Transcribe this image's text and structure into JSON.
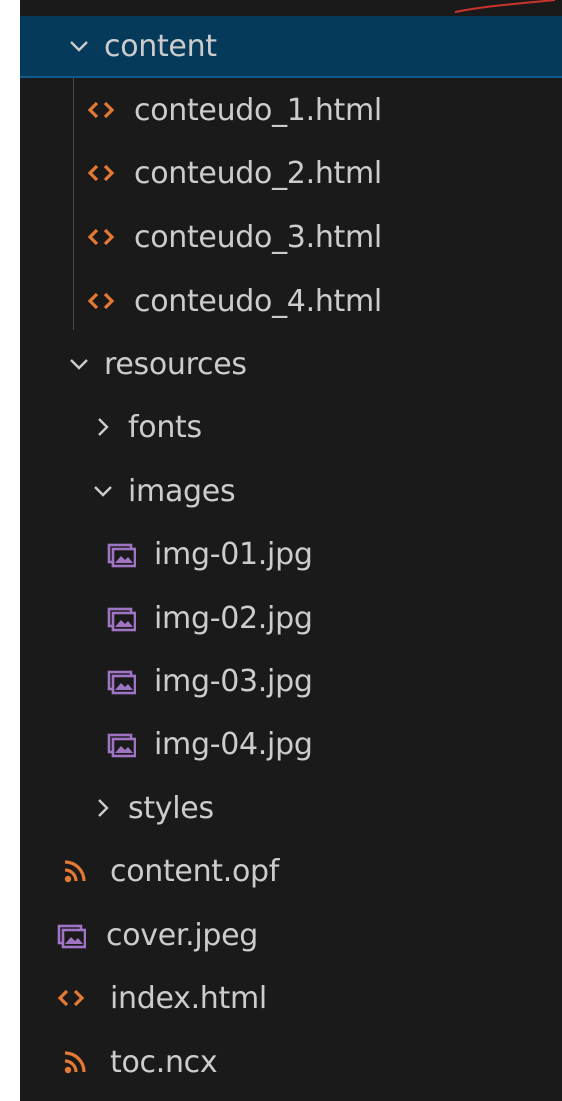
{
  "explorer": {
    "content_folder": "content",
    "content_files": [
      "conteudo_1.html",
      "conteudo_2.html",
      "conteudo_3.html",
      "conteudo_4.html"
    ],
    "resources_folder": "resources",
    "fonts_folder": "fonts",
    "images_folder": "images",
    "image_files": [
      "img-01.jpg",
      "img-02.jpg",
      "img-03.jpg",
      "img-04.jpg"
    ],
    "styles_folder": "styles",
    "root_files": [
      "content.opf",
      "cover.jpeg",
      "index.html",
      "toc.ncx"
    ]
  },
  "icons": {
    "chevron_down": "chevron-down-icon",
    "chevron_right": "chevron-right-icon",
    "html": "html-file-icon",
    "image": "image-file-icon",
    "rss": "rss-file-icon"
  },
  "colors": {
    "background": "#1a1a1a",
    "selected_row": "#063a5a",
    "text": "#cccccc",
    "html_icon": "#e37933",
    "image_icon": "#a074c4",
    "rss_icon": "#e37933"
  }
}
